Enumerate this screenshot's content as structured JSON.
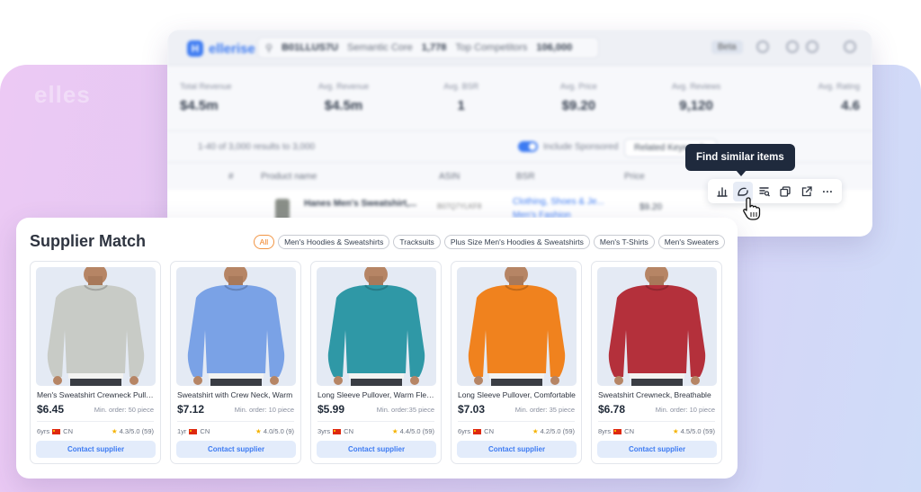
{
  "background": {
    "watermark": "elles"
  },
  "app": {
    "logo_letter": "H",
    "logo_text": "ellerise",
    "search_query": "B01LLUS7U",
    "semantic_label": "Semantic Core",
    "semantic_value": "1,778",
    "competitors_label": "Top Competitors",
    "competitors_value": "106,000",
    "beta": "Beta",
    "stats": [
      {
        "label": "Total Revenue",
        "value": "$4.5m"
      },
      {
        "label": "Avg. Revenue",
        "value": "$4.5m"
      },
      {
        "label": "Avg. BSR",
        "value": "1"
      },
      {
        "label": "Avg. Price",
        "value": "$9.20"
      },
      {
        "label": "Avg. Reviews",
        "value": "9,120"
      },
      {
        "label": "Avg. Rating",
        "value": "4.6"
      }
    ],
    "results_count": "1-40 of 3,000 results to 3,000",
    "include_sponsored": "Include Sponsored",
    "related_keywords": "Related Keywords",
    "columns": {
      "num": "#",
      "product": "Product name",
      "asin": "ASIN",
      "bsr": "BSR",
      "price": "Price"
    },
    "row": {
      "product": "Hanes Men's Sweatshirt,...",
      "asin": "B07Q7YLKF8",
      "category_1": "Clothing, Shoes & Je...",
      "category_2": "Men's Fashion",
      "price": "$9.20"
    }
  },
  "tooltip": {
    "text": "Find similar items"
  },
  "actions": [
    {
      "icon": "bar-chart-icon"
    },
    {
      "icon": "find-similar-icon"
    },
    {
      "icon": "text-search-icon"
    },
    {
      "icon": "copy-icon"
    },
    {
      "icon": "external-link-icon"
    },
    {
      "icon": "more-icon",
      "glyph": "···"
    }
  ],
  "supplier_match": {
    "title": "Supplier Match",
    "filters": [
      {
        "label": "All",
        "active": true
      },
      {
        "label": "Men's Hoodies & Sweatshirts"
      },
      {
        "label": "Tracksuits"
      },
      {
        "label": "Plus Size Men's Hoodies & Sweatshirts"
      },
      {
        "label": "Men's T-Shirts"
      },
      {
        "label": "Men's Sweaters"
      }
    ],
    "products": [
      {
        "title": "Men's Sweatshirt Crewneck Pullover",
        "price": "$6.45",
        "min_order": "Min. order: 50 piece",
        "years": "6yrs",
        "country": "CN",
        "rating": "4.3/5.0 (59)",
        "contact": "Contact supplier",
        "color": "#c8cbc6"
      },
      {
        "title": "Sweatshirt with Crew Neck, Warm",
        "price": "$7.12",
        "min_order": "Min. order: 10 piece",
        "years": "1yr",
        "country": "CN",
        "rating": "4.0/5.0 (9)",
        "contact": "Contact supplier",
        "color": "#7aa2e6"
      },
      {
        "title": "Long Sleeve Pullover, Warm Fleece",
        "price": "$5.99",
        "min_order": "Min. order:35 piece",
        "years": "3yrs",
        "country": "CN",
        "rating": "4.4/5.0 (59)",
        "contact": "Contact supplier",
        "color": "#2f98a6"
      },
      {
        "title": "Long Sleeve Pullover, Comfortable",
        "price": "$7.03",
        "min_order": "Min. order: 35 piece",
        "years": "6yrs",
        "country": "CN",
        "rating": "4.2/5.0 (59)",
        "contact": "Contact supplier",
        "color": "#f0821e"
      },
      {
        "title": "Sweatshirt Crewneck, Breathable",
        "price": "$6.78",
        "min_order": "Min. order: 10 piece",
        "years": "8yrs",
        "country": "CN",
        "rating": "4.5/5.0 (59)",
        "contact": "Contact supplier",
        "color": "#b4303b"
      }
    ]
  }
}
